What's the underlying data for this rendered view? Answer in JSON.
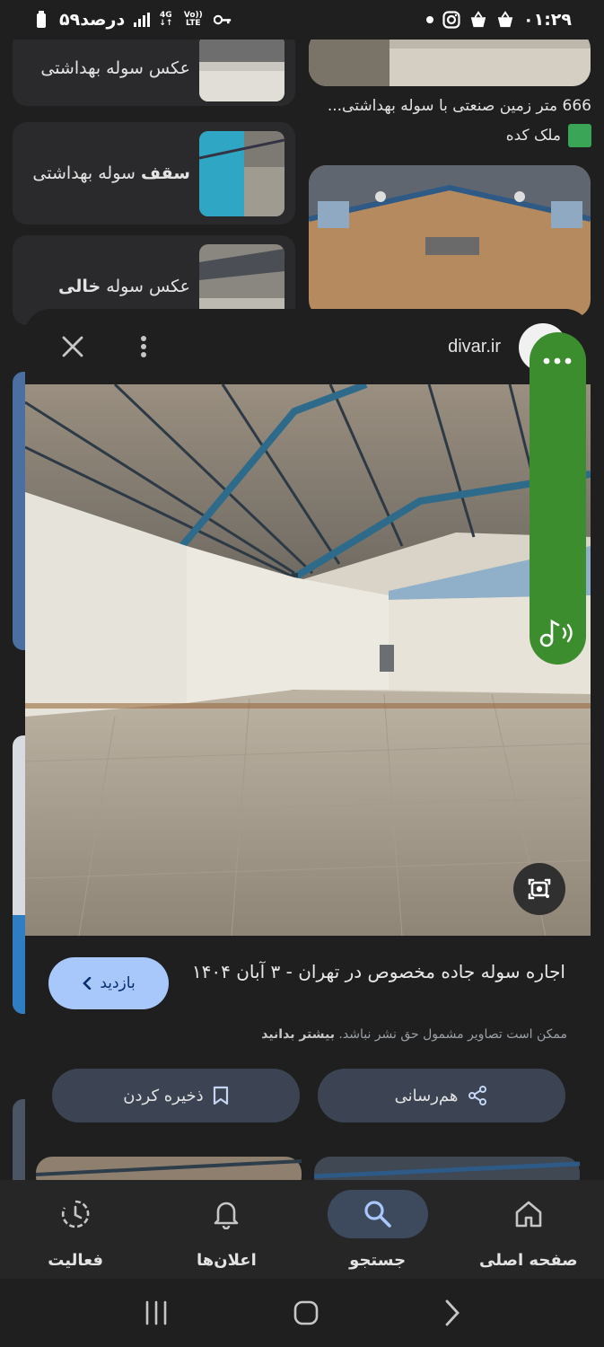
{
  "status_bar": {
    "time": "۰۱:۲۹",
    "battery": "۵۹درصد",
    "network": "4G",
    "volte": "Vo)) LTE"
  },
  "background_results": {
    "card1_caption": "عکس سوله بهداشتی",
    "card2_caption_bold": "سقف",
    "card2_caption_rest": " سوله بهداشتی",
    "card3_caption_rest": "عکس سوله ",
    "card3_caption_bold": "خالی",
    "right_result_title": "666 متر زمین صنعتی با سوله بهداشتی...",
    "right_result_source": "ملک کده"
  },
  "viewer": {
    "site": "divar.ir",
    "title": "اجاره سوله جاده مخصوص در تهران - ۳ آبان ۱۴۰۴",
    "visit_label": "بازدید",
    "notice_text": "ممکن است تصاویر مشمول حق نشر نباشد.",
    "notice_link": "بیشتر بدانید",
    "share_label": "هم‌رسانی",
    "save_label": "ذخیره کردن"
  },
  "bottom_nav": {
    "home": "صفحه اصلی",
    "search": "جستجو",
    "notifications": "اعلان‌ها",
    "activity": "فعالیت",
    "active": "search"
  },
  "colors": {
    "background": "#1f1f1f",
    "card": "#2a2a2c",
    "accent_button": "#a8c7fa",
    "assistant_green": "#3b8d2e",
    "nav_active": "#3d4a5e"
  }
}
